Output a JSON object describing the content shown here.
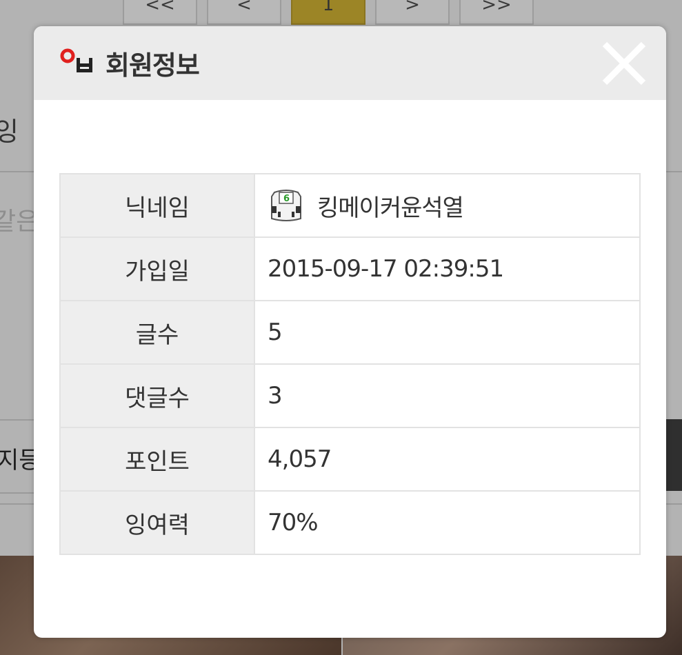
{
  "background": {
    "pager": [
      "<<",
      "<",
      "1",
      ">",
      ">>"
    ],
    "fragments": [
      "잉",
      "같은",
      "지등"
    ]
  },
  "modal": {
    "title": "회원정보",
    "title_icon_letters": "OH",
    "close_icon": "close-icon",
    "rows": [
      {
        "label": "닉네임",
        "value": "킹메이커윤석열",
        "level_badge": "6"
      },
      {
        "label": "가입일",
        "value": "2015-09-17 02:39:51"
      },
      {
        "label": "글수",
        "value": "5"
      },
      {
        "label": "댓글수",
        "value": "3"
      },
      {
        "label": "포인트",
        "value": "4,057"
      },
      {
        "label": "잉여력",
        "value": "70%"
      }
    ]
  },
  "colors": {
    "header_bg": "#ebebeb",
    "label_bg": "#eeeeee",
    "text": "#333333",
    "icon_red": "#e0201e",
    "level_green": "#2a9a2a",
    "pager_active": "#9c8526"
  }
}
